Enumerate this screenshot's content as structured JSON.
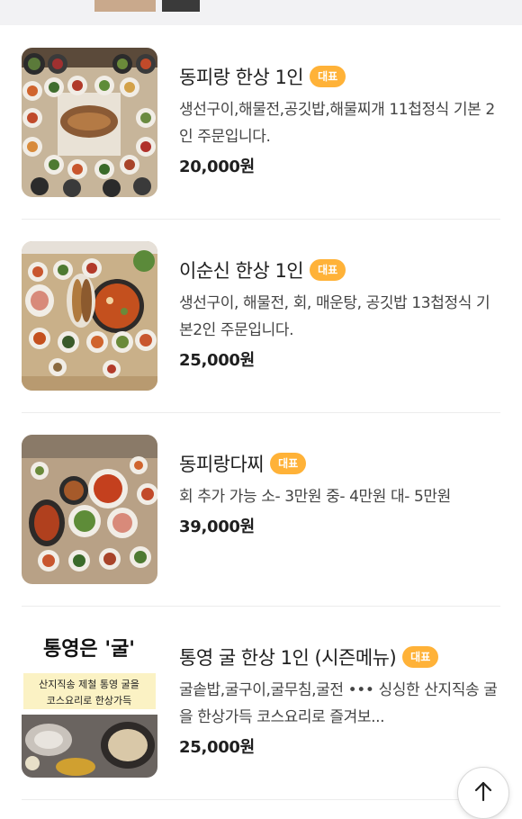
{
  "menu": {
    "items": [
      {
        "name": "동피랑 한상 1인",
        "badge": "대표",
        "description": "생선구이,해물전,공깃밥,해물찌개 11첩정식 기본 2인 주문입니다.",
        "price": "20,000원"
      },
      {
        "name": "이순신 한상 1인",
        "badge": "대표",
        "description": "생선구이, 해물전, 회, 매운탕, 공깃밥 13첩정식 기본2인 주문입니다.",
        "price": "25,000원"
      },
      {
        "name": "동피랑다찌",
        "badge": "대표",
        "description": "회 추가 가능 소- 3만원 중- 4만원 대- 5만원",
        "price": "39,000원"
      },
      {
        "name": "통영 굴 한상 1인 (시즌메뉴)",
        "badge": "대표",
        "description": "굴솥밥,굴구이,굴무침,굴전 ••• 싱싱한 산지직송 굴을 한상가득 코스요리로 즐겨보...",
        "price": "25,000원",
        "image_text": {
          "headline": "통영은 '굴'",
          "line1": "산지직송 제철 통영 굴을",
          "line2": "코스요리로 한상가득"
        }
      }
    ]
  },
  "icons": {
    "scroll_top": "arrow-up-icon"
  },
  "colors": {
    "badge": "#ffb238",
    "accent_text": "#1e1e1e"
  }
}
